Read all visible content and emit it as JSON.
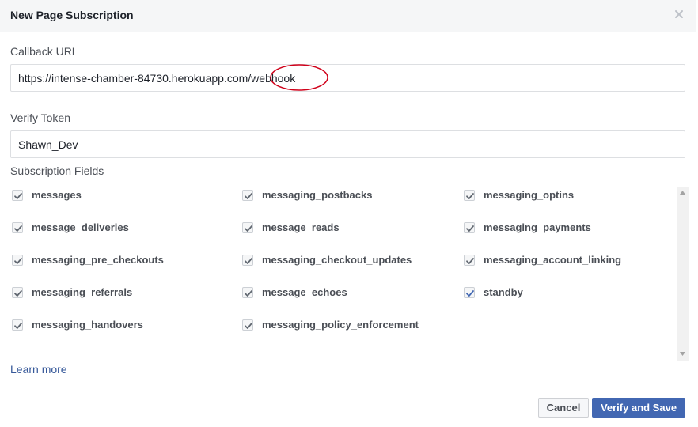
{
  "dialog": {
    "title": "New Page Subscription",
    "close_icon": "close-icon"
  },
  "callback": {
    "label": "Callback URL",
    "value": "https://intense-chamber-84730.herokuapp.com/webhook",
    "annotation_color": "#d0021b"
  },
  "verify": {
    "label": "Verify Token",
    "value": "Shawn_Dev"
  },
  "subscription": {
    "label": "Subscription Fields",
    "fields": [
      {
        "label": "messages",
        "checked": true
      },
      {
        "label": "messaging_postbacks",
        "checked": true
      },
      {
        "label": "messaging_optins",
        "checked": true
      },
      {
        "label": "message_deliveries",
        "checked": true
      },
      {
        "label": "message_reads",
        "checked": true
      },
      {
        "label": "messaging_payments",
        "checked": true
      },
      {
        "label": "messaging_pre_checkouts",
        "checked": true
      },
      {
        "label": "messaging_checkout_updates",
        "checked": true
      },
      {
        "label": "messaging_account_linking",
        "checked": true
      },
      {
        "label": "messaging_referrals",
        "checked": true
      },
      {
        "label": "message_echoes",
        "checked": true
      },
      {
        "label": "standby",
        "checked": true
      },
      {
        "label": "messaging_handovers",
        "checked": true
      },
      {
        "label": "messaging_policy_enforcement",
        "checked": true
      }
    ]
  },
  "learn_more": "Learn more",
  "footer": {
    "cancel_label": "Cancel",
    "save_label": "Verify and Save"
  },
  "colors": {
    "primary": "#4267b2",
    "link": "#365899",
    "header_bg": "#f5f6f7"
  }
}
